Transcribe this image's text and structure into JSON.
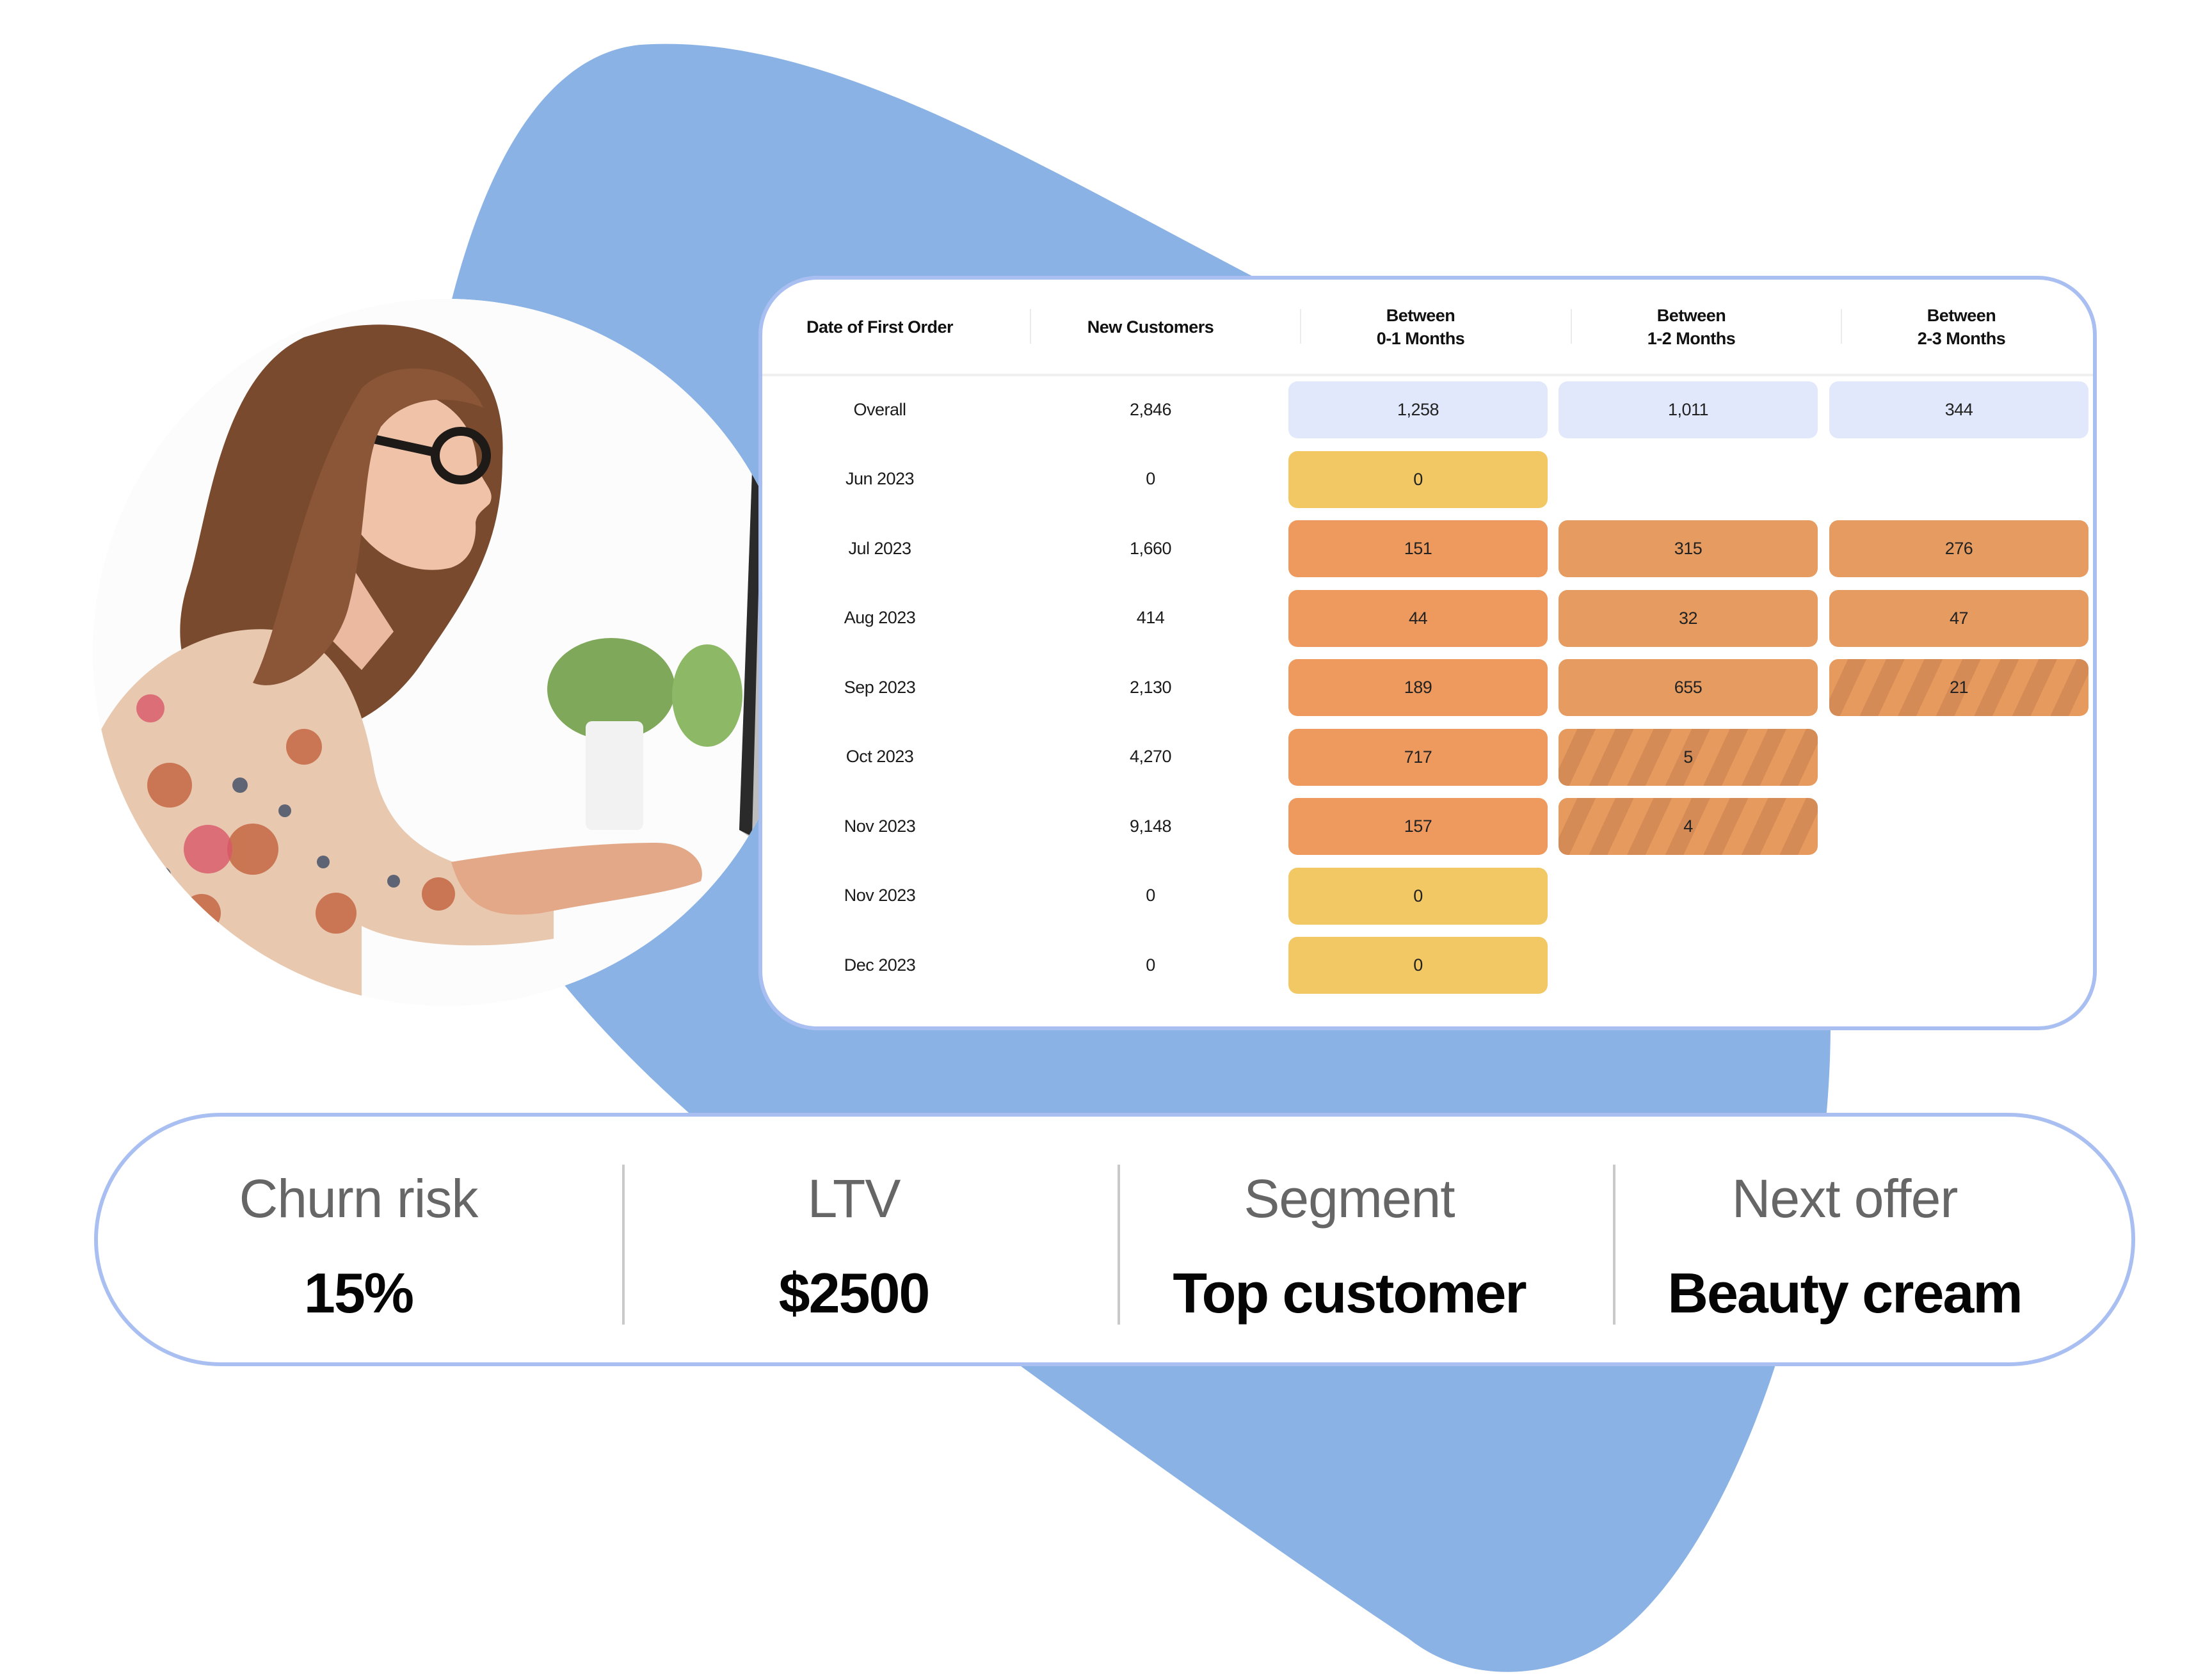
{
  "colors": {
    "blob": "#8AB2E5",
    "card_border": "#A9BFF2",
    "overall_cell": "#E1E8FB",
    "zero_cell": "#F1C864",
    "retention_cell": "#EE9A5E",
    "partial_cell_stripe": "#D48B55"
  },
  "illustration": {
    "photo_alt": "woman-with-glasses-typing-at-computer"
  },
  "cohort_table": {
    "headers": [
      "Date of First Order",
      "New Customers",
      "Between\n0-1 Months",
      "Between\n1-2 Months",
      "Between\n2-3 Months"
    ],
    "rows": [
      {
        "date": "Overall",
        "new": "2,846",
        "m0_1": "1,258",
        "m1_2": "1,011",
        "m2_3": "344",
        "kind": [
          "overall",
          "overall",
          "overall"
        ]
      },
      {
        "date": "Jun 2023",
        "new": "0",
        "m0_1": "0",
        "m1_2": null,
        "m2_3": null,
        "kind": [
          "zero",
          null,
          null
        ]
      },
      {
        "date": "Jul 2023",
        "new": "1,660",
        "m0_1": "151",
        "m1_2": "315",
        "m2_3": "276",
        "kind": [
          "mid",
          "mid2",
          "mid2"
        ]
      },
      {
        "date": "Aug 2023",
        "new": "414",
        "m0_1": "44",
        "m1_2": "32",
        "m2_3": "47",
        "kind": [
          "mid",
          "mid2",
          "mid2"
        ]
      },
      {
        "date": "Sep 2023",
        "new": "2,130",
        "m0_1": "189",
        "m1_2": "655",
        "m2_3": "21",
        "kind": [
          "mid",
          "mid2",
          "partial"
        ]
      },
      {
        "date": "Oct 2023",
        "new": "4,270",
        "m0_1": "717",
        "m1_2": "5",
        "m2_3": null,
        "kind": [
          "mid",
          "partial",
          null
        ]
      },
      {
        "date": "Nov 2023",
        "new": "9,148",
        "m0_1": "157",
        "m1_2": "4",
        "m2_3": null,
        "kind": [
          "mid",
          "partial",
          null
        ]
      },
      {
        "date": "Nov 2023",
        "new": "0",
        "m0_1": "0",
        "m1_2": null,
        "m2_3": null,
        "kind": [
          "zero",
          null,
          null
        ]
      },
      {
        "date": "Dec 2023",
        "new": "0",
        "m0_1": "0",
        "m1_2": null,
        "m2_3": null,
        "kind": [
          "zero",
          null,
          null
        ]
      }
    ]
  },
  "metrics": [
    {
      "label": "Churn risk",
      "value": "15%"
    },
    {
      "label": "LTV",
      "value": "$2500"
    },
    {
      "label": "Segment",
      "value": "Top customer"
    },
    {
      "label": "Next offer",
      "value": "Beauty cream"
    }
  ]
}
